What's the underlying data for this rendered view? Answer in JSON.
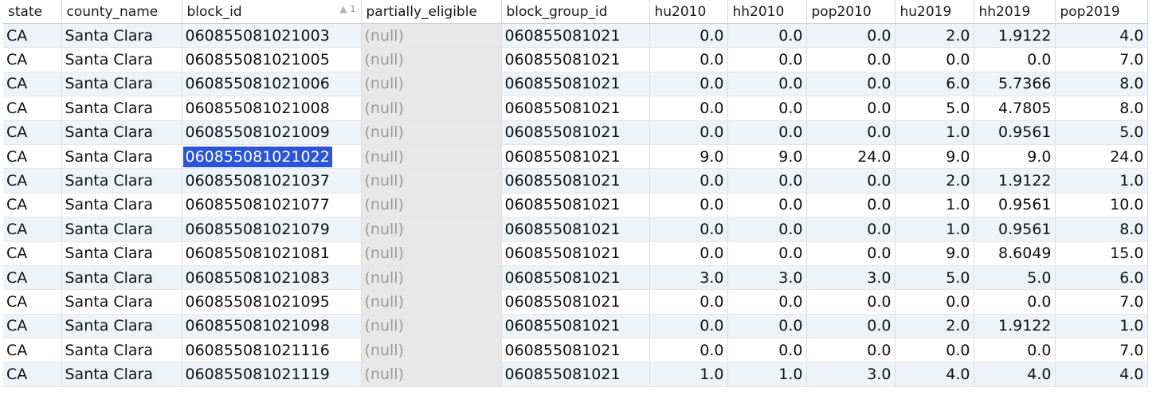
{
  "table": {
    "columns": [
      {
        "key": "state",
        "label": "state"
      },
      {
        "key": "county_name",
        "label": "county_name"
      },
      {
        "key": "block_id",
        "label": "block_id",
        "sort_order": "1"
      },
      {
        "key": "partially_eligible",
        "label": "partially_eligible"
      },
      {
        "key": "block_group_id",
        "label": "block_group_id"
      },
      {
        "key": "hu2010",
        "label": "hu2010"
      },
      {
        "key": "hh2010",
        "label": "hh2010"
      },
      {
        "key": "pop2010",
        "label": "pop2010"
      },
      {
        "key": "hu2019",
        "label": "hu2019"
      },
      {
        "key": "hh2019",
        "label": "hh2019"
      },
      {
        "key": "pop2019",
        "label": "pop2019"
      }
    ],
    "selected_row_index": 5,
    "selected_column": "block_id",
    "rows": [
      [
        "CA",
        "Santa Clara",
        "060855081021003",
        "(null)",
        "060855081021",
        "0.0",
        "0.0",
        "0.0",
        "2.0",
        "1.9122",
        "4.0"
      ],
      [
        "CA",
        "Santa Clara",
        "060855081021005",
        "(null)",
        "060855081021",
        "0.0",
        "0.0",
        "0.0",
        "0.0",
        "0.0",
        "7.0"
      ],
      [
        "CA",
        "Santa Clara",
        "060855081021006",
        "(null)",
        "060855081021",
        "0.0",
        "0.0",
        "0.0",
        "6.0",
        "5.7366",
        "8.0"
      ],
      [
        "CA",
        "Santa Clara",
        "060855081021008",
        "(null)",
        "060855081021",
        "0.0",
        "0.0",
        "0.0",
        "5.0",
        "4.7805",
        "8.0"
      ],
      [
        "CA",
        "Santa Clara",
        "060855081021009",
        "(null)",
        "060855081021",
        "0.0",
        "0.0",
        "0.0",
        "1.0",
        "0.9561",
        "5.0"
      ],
      [
        "CA",
        "Santa Clara",
        "060855081021022",
        "(null)",
        "060855081021",
        "9.0",
        "9.0",
        "24.0",
        "9.0",
        "9.0",
        "24.0"
      ],
      [
        "CA",
        "Santa Clara",
        "060855081021037",
        "(null)",
        "060855081021",
        "0.0",
        "0.0",
        "0.0",
        "2.0",
        "1.9122",
        "1.0"
      ],
      [
        "CA",
        "Santa Clara",
        "060855081021077",
        "(null)",
        "060855081021",
        "0.0",
        "0.0",
        "0.0",
        "1.0",
        "0.9561",
        "10.0"
      ],
      [
        "CA",
        "Santa Clara",
        "060855081021079",
        "(null)",
        "060855081021",
        "0.0",
        "0.0",
        "0.0",
        "1.0",
        "0.9561",
        "8.0"
      ],
      [
        "CA",
        "Santa Clara",
        "060855081021081",
        "(null)",
        "060855081021",
        "0.0",
        "0.0",
        "0.0",
        "9.0",
        "8.6049",
        "15.0"
      ],
      [
        "CA",
        "Santa Clara",
        "060855081021083",
        "(null)",
        "060855081021",
        "3.0",
        "3.0",
        "3.0",
        "5.0",
        "5.0",
        "6.0"
      ],
      [
        "CA",
        "Santa Clara",
        "060855081021095",
        "(null)",
        "060855081021",
        "0.0",
        "0.0",
        "0.0",
        "0.0",
        "0.0",
        "7.0"
      ],
      [
        "CA",
        "Santa Clara",
        "060855081021098",
        "(null)",
        "060855081021",
        "0.0",
        "0.0",
        "0.0",
        "2.0",
        "1.9122",
        "1.0"
      ],
      [
        "CA",
        "Santa Clara",
        "060855081021116",
        "(null)",
        "060855081021",
        "0.0",
        "0.0",
        "0.0",
        "0.0",
        "0.0",
        "7.0"
      ],
      [
        "CA",
        "Santa Clara",
        "060855081021119",
        "(null)",
        "060855081021",
        "1.0",
        "1.0",
        "3.0",
        "4.0",
        "4.0",
        "4.0"
      ]
    ]
  },
  "colors": {
    "selection": "#2a55d8",
    "row_stripe": "#eef3fa",
    "null_bg": "#e8e8e8",
    "null_text": "#9a9a9a"
  }
}
